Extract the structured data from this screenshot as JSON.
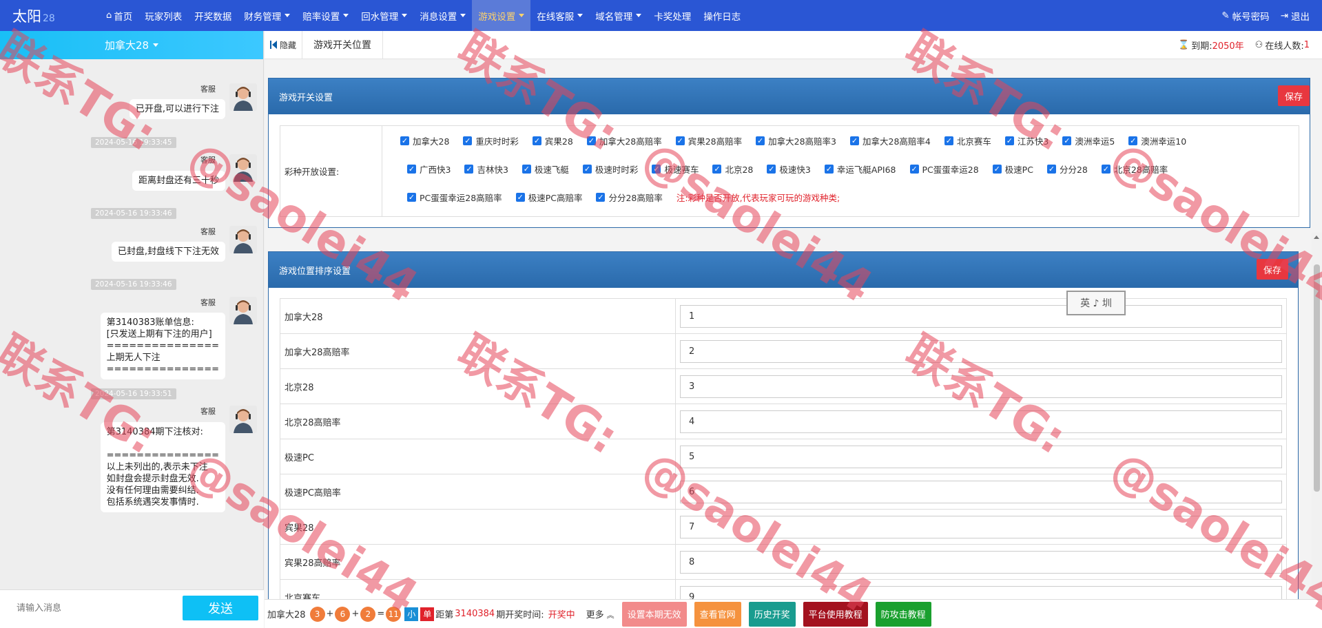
{
  "nav": {
    "brand": "太阳",
    "brand_sub": "28",
    "items": [
      {
        "label": "首页",
        "caret": false,
        "active": false,
        "home": true
      },
      {
        "label": "玩家列表",
        "caret": false,
        "active": false
      },
      {
        "label": "开奖数据",
        "caret": false,
        "active": false
      },
      {
        "label": "财务管理",
        "caret": true,
        "active": false
      },
      {
        "label": "赔率设置",
        "caret": true,
        "active": false
      },
      {
        "label": "回水管理",
        "caret": true,
        "active": false
      },
      {
        "label": "消息设置",
        "caret": true,
        "active": false
      },
      {
        "label": "游戏设置",
        "caret": true,
        "active": true
      },
      {
        "label": "在线客服",
        "caret": true,
        "active": false
      },
      {
        "label": "域名管理",
        "caret": true,
        "active": false
      },
      {
        "label": "卡奖处理",
        "caret": false,
        "active": false
      },
      {
        "label": "操作日志",
        "caret": false,
        "active": false
      }
    ],
    "account": "帐号密码",
    "logout": "退出"
  },
  "chat": {
    "room": "加拿大28",
    "messages": [
      {
        "sender": "客服",
        "text": "已开盘,可以进行下注"
      },
      {
        "sender": "客服",
        "text": "距离封盘还有三十秒"
      },
      {
        "sender": "客服",
        "text": "已封盘,封盘线下下注无效"
      },
      {
        "sender": "客服",
        "text": "第3140383账单信息:\n[只发送上期有下注的用户]\n===============\n上期无人下注\n==============="
      },
      {
        "sender": "客服",
        "text": "第3140384期下注核对:\n\n===============\n以上未列出的,表示未下注\n如封盘会提示封盘无效.\n没有任何理由需要纠结.\n包括系统遇突发事情时."
      }
    ],
    "timestamps": [
      "2024-05-16 19:33:45",
      "2024-05-16 19:33:46",
      "2024-05-16 19:33:46",
      "2024-05-16 19:33:51"
    ],
    "input_placeholder": "请输入消息",
    "send_label": "发送"
  },
  "subbar": {
    "hide_label": "隐藏",
    "tab": "游戏开关位置",
    "expire_label": "到期:",
    "expire_value": "2050年",
    "online_label": "在线人数:",
    "online_value": "1"
  },
  "switch_panel": {
    "title": "游戏开关设置",
    "save": "保存",
    "row_label": "彩种开放设置:",
    "rows": [
      [
        "加拿大28",
        "重庆时时彩",
        "宾果28",
        "加拿大28高赔率",
        "宾果28高赔率",
        "加拿大28高赔率3",
        "加拿大28高赔率4",
        "北京赛车",
        "江苏快3",
        "澳洲幸运5",
        "澳洲幸运10"
      ],
      [
        "广西快3",
        "吉林快3",
        "极速飞艇",
        "极速时时彩",
        "极速赛车",
        "北京28",
        "极速快3",
        "幸运飞艇API68",
        "PC蛋蛋幸运28",
        "极速PC",
        "分分28",
        "北京28高赔率"
      ],
      [
        "PC蛋蛋幸运28高赔率",
        "极速PC高赔率",
        "分分28高赔率"
      ]
    ],
    "note": "注:彩种是否开放,代表玩家可玩的游戏种类;"
  },
  "order_panel": {
    "title": "游戏位置排序设置",
    "save": "保存",
    "rows": [
      {
        "name": "加拿大28",
        "value": "1"
      },
      {
        "name": "加拿大28高赔率",
        "value": "2"
      },
      {
        "name": "北京28",
        "value": "3"
      },
      {
        "name": "北京28高赔率",
        "value": "4"
      },
      {
        "name": "极速PC",
        "value": "5"
      },
      {
        "name": "极速PC高赔率",
        "value": "6"
      },
      {
        "name": "宾果28",
        "value": "7"
      },
      {
        "name": "宾果28高赔率",
        "value": "8"
      },
      {
        "name": "北京赛车",
        "value": "9"
      }
    ]
  },
  "ime": "英 ♪ 圳",
  "bottom": {
    "game": "加拿大28",
    "balls": [
      "3",
      "6",
      "2"
    ],
    "plus": "+",
    "equals": "=",
    "sum": "11",
    "size": "小",
    "parity": "单",
    "period_prefix": "距第",
    "period": "3140384",
    "period_suffix": "期开奖时间:",
    "status": "开奖中",
    "more": "更多",
    "buttons": [
      {
        "label": "设置本期无效",
        "color": "#f28b8b"
      },
      {
        "label": "查看官网",
        "color": "#f5923e"
      },
      {
        "label": "历史开奖",
        "color": "#199c8f"
      },
      {
        "label": "平台使用教程",
        "color": "#a3121f"
      },
      {
        "label": "防攻击教程",
        "color": "#1aa02e"
      }
    ]
  },
  "watermark": {
    "line1": "联系TG:",
    "line2": "@saolei44",
    "color": "#e6465a"
  }
}
